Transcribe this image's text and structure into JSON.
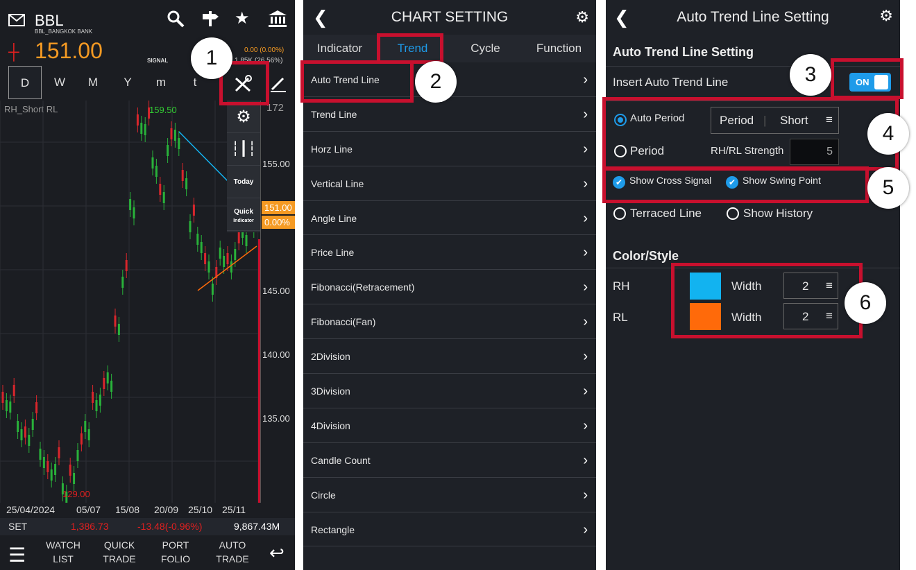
{
  "panel1": {
    "symbol": "BBL",
    "company": "BBL_BANGKOK BANK",
    "price": "151.00",
    "signal_label": "SIGNAL",
    "change": "0.00 (0.00%)",
    "volume": "1.85K (26.56%)",
    "periods": [
      "D",
      "W",
      "M",
      "Y",
      "m",
      "t"
    ],
    "chart_label": "RH_Short RL",
    "axis": [
      "155.00",
      "145.00",
      "140.00",
      "135.00"
    ],
    "axis_top": "172",
    "high_label": "159.50",
    "low_label": "129.00",
    "price_tag": "151.00",
    "price_tag_pct": "0.00%",
    "dates": [
      "25/04/2024",
      "05/07",
      "15/08",
      "20/09",
      "25/10",
      "25/11"
    ],
    "set_label": "SET",
    "set_value": "1,386.73",
    "set_change": "-13.48(-0.96%)",
    "set_volume": "9,867.43M",
    "side_menu": [
      "",
      "",
      "Today",
      "Quick"
    ],
    "side_sub": "Indicator",
    "nav": [
      {
        "l1": "WATCH",
        "l2": "LIST"
      },
      {
        "l1": "QUICK",
        "l2": "TRADE"
      },
      {
        "l1": "PORT",
        "l2": "FOLIO"
      },
      {
        "l1": "AUTO",
        "l2": "TRADE"
      }
    ]
  },
  "panel2": {
    "title": "CHART SETTING",
    "tabs": [
      "Indicator",
      "Trend",
      "Cycle",
      "Function"
    ],
    "items": [
      "Auto Trend Line",
      "Trend Line",
      "Horz Line",
      "Vertical Line",
      "Angle Line",
      "Price Line",
      "Fibonacci(Retracement)",
      "Fibonacci(Fan)",
      "2Division",
      "3Division",
      "4Division",
      "Candle Count",
      "Circle",
      "Rectangle"
    ]
  },
  "panel3": {
    "title": "Auto Trend Line Setting",
    "section1": "Auto Trend Line Setting",
    "insert_label": "Insert Auto Trend Line",
    "toggle": "ON",
    "auto_period": "Auto Period",
    "period": "Period",
    "period_sel_a": "Period",
    "period_sel_b": "Short",
    "strength_label": "RH/RL Strength",
    "strength_value": "5",
    "show_cross": "Show Cross Signal",
    "show_swing": "Show Swing Point",
    "terraced": "Terraced Line",
    "history": "Show History",
    "section2": "Color/Style",
    "rh": "RH",
    "rl": "RL",
    "width_label": "Width",
    "rh_width": "2",
    "rl_width": "2",
    "rh_color": "#12b3f0",
    "rl_color": "#ff6a0a"
  },
  "callouts": [
    "1",
    "2",
    "3",
    "4",
    "5",
    "6"
  ]
}
